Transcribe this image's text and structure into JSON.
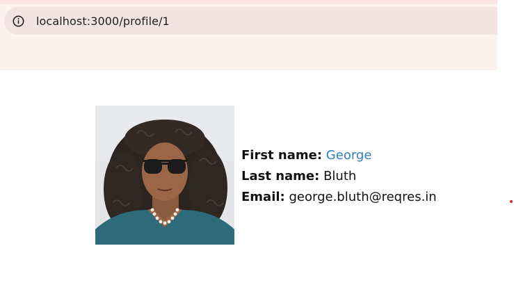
{
  "browser": {
    "url": "localhost:3000/profile/1",
    "info_icon": "info-circle-icon"
  },
  "profile": {
    "avatar_icon": "user-photo",
    "fields": {
      "first_name_label": "First name:",
      "first_name_value": "George",
      "last_name_label": "Last name:",
      "last_name_value": "Bluth",
      "email_label": "Email:",
      "email_value": "george.bluth@reqres.in"
    }
  },
  "colors": {
    "link": "#2a7fc9",
    "chrome_bg": "#fdf2f0",
    "address_bar_bg": "#f3e4e3",
    "indicator": "#e0231d"
  }
}
